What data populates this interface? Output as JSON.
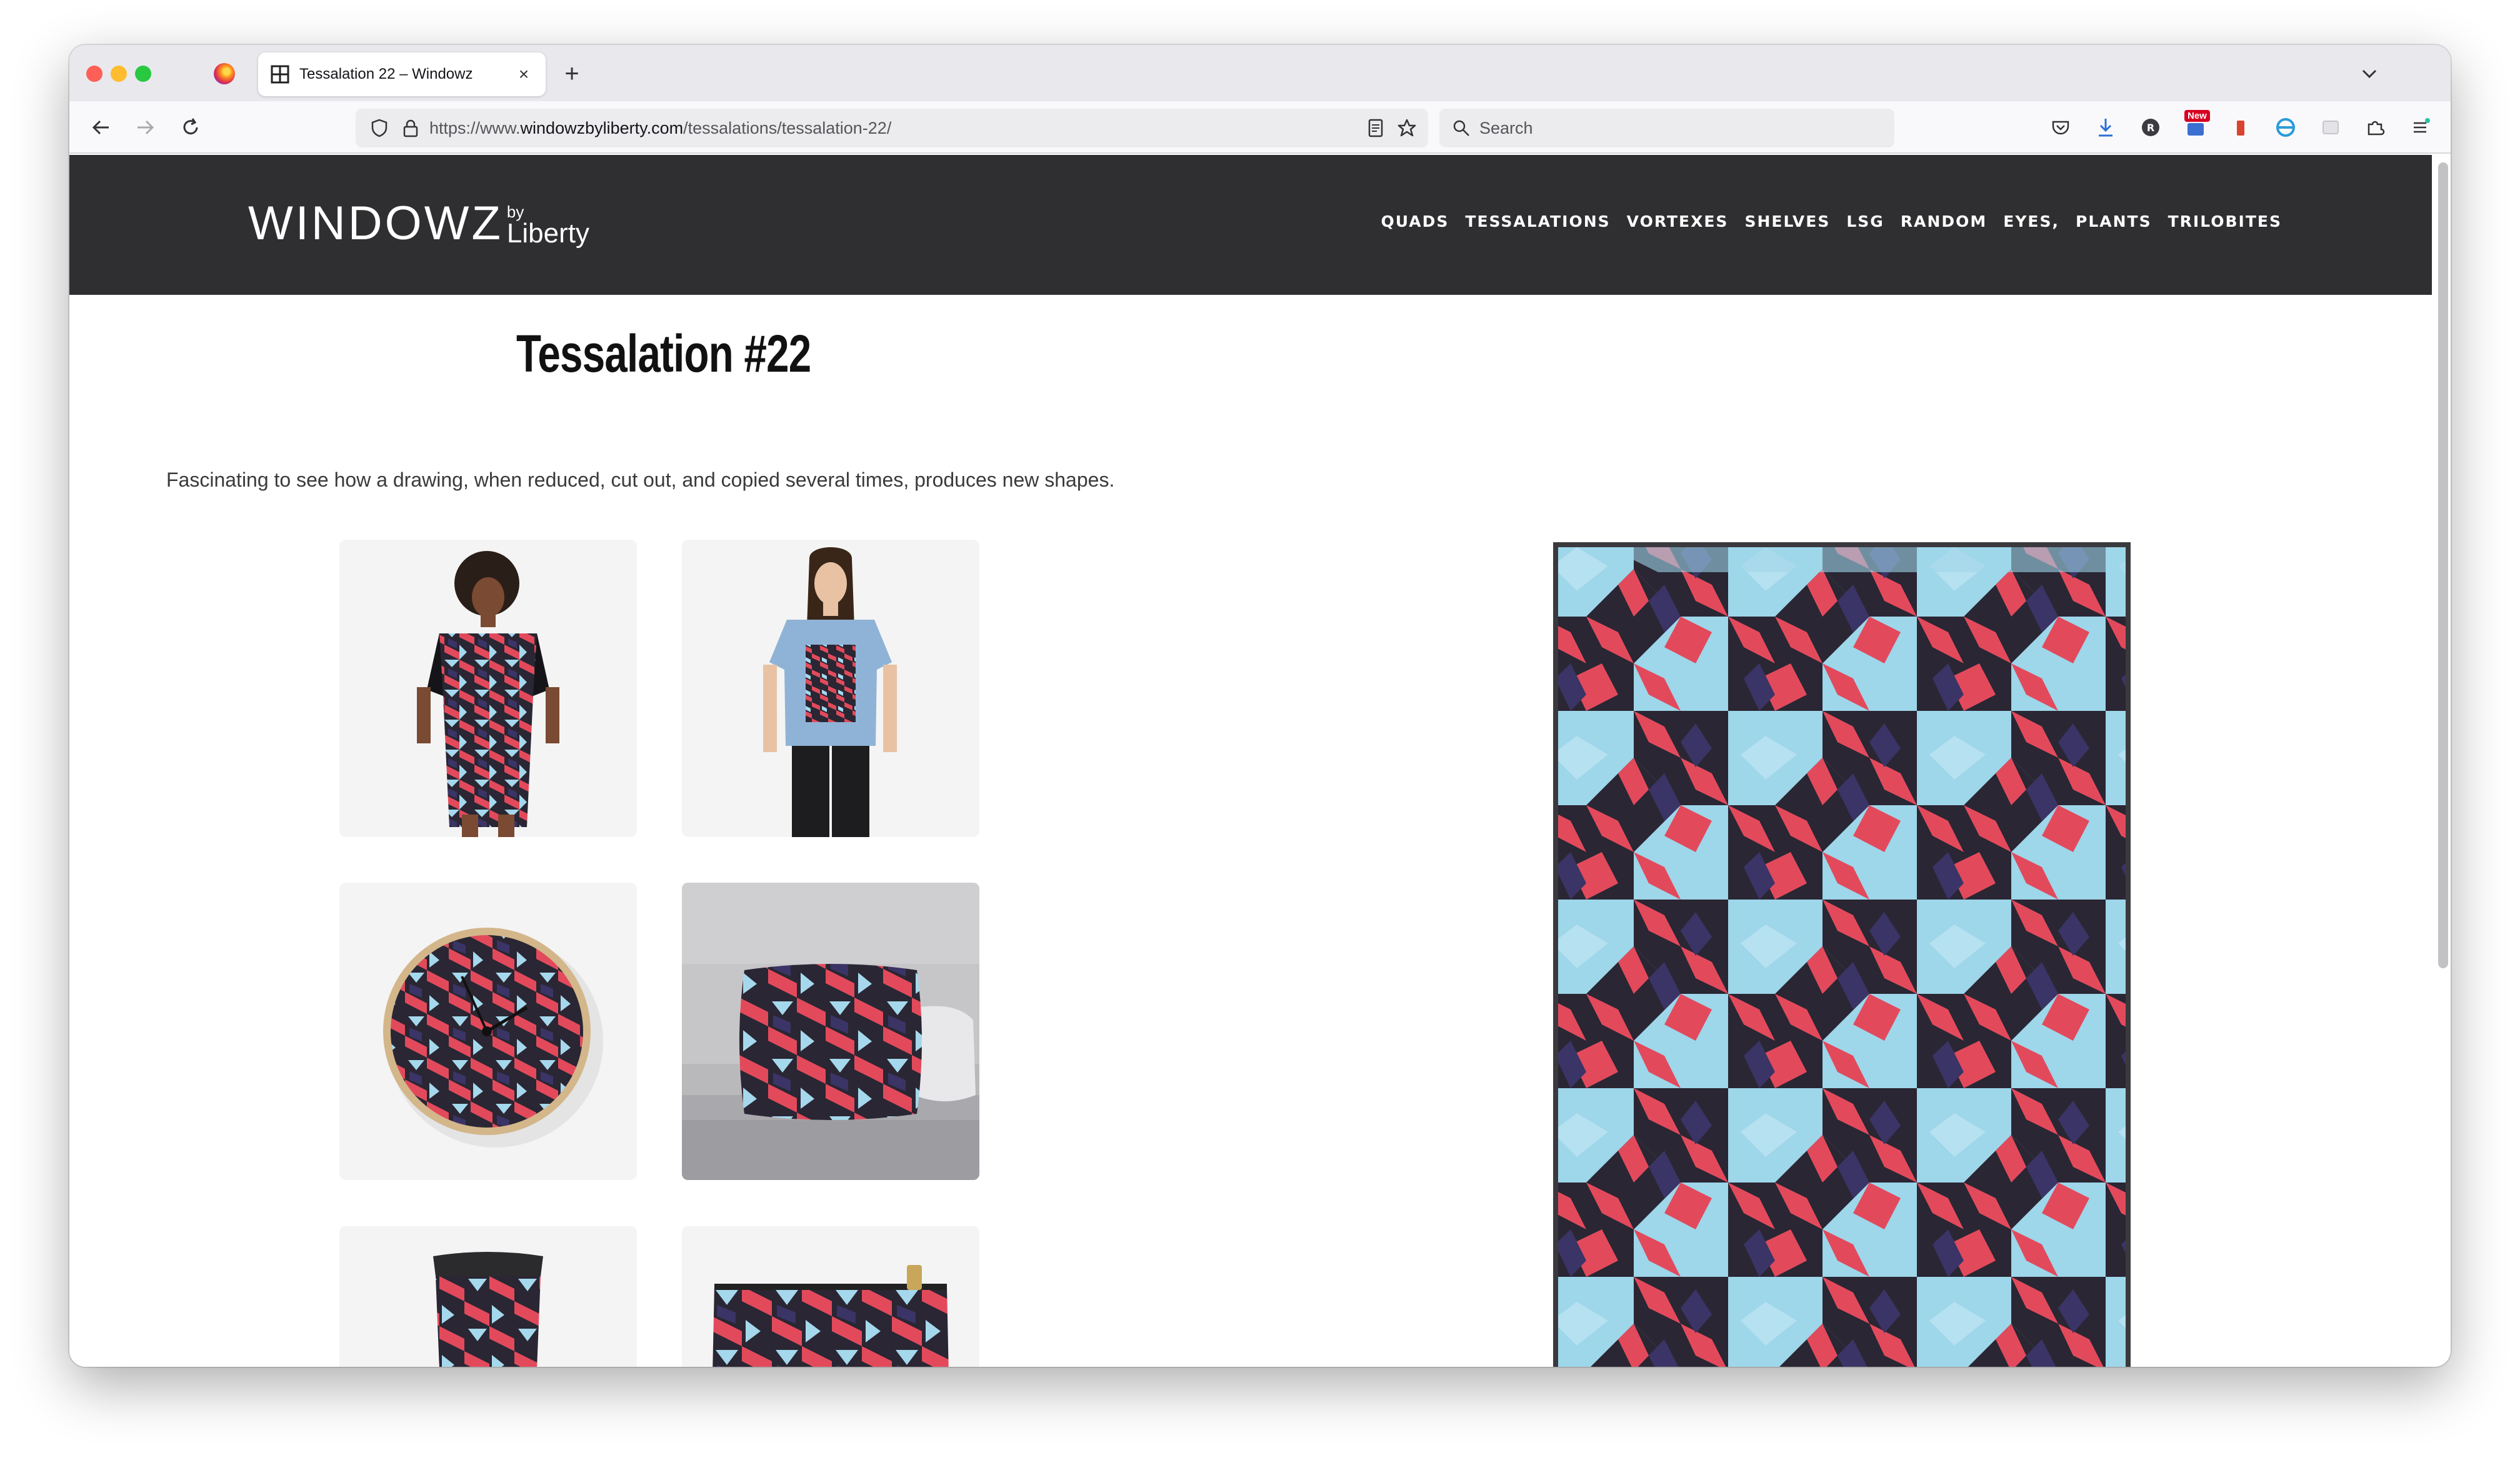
{
  "browser": {
    "tab_title": "Tessalation 22 – Windowz",
    "tab_close": "×",
    "new_tab": "+",
    "url_prefix": "https://www.",
    "url_domain": "windowzbyliberty.com",
    "url_path": "/tessalations/tessalation-22/",
    "search_placeholder": "Search",
    "badge_new": "New"
  },
  "site": {
    "logo_main": "WINDOWZ",
    "logo_by": "by",
    "logo_liberty": "Liberty",
    "menu": [
      "QUADS",
      "TESSALATIONS",
      "VORTEXES",
      "SHELVES",
      "LSG",
      "RANDOM",
      "EYES,",
      "PLANTS",
      "TRILOBITES"
    ]
  },
  "content": {
    "title": "Tessalation #22",
    "description": "Fascinating to see how a drawing, when reduced, cut out, and copied several times, produces new shapes."
  },
  "products": [
    "graphic-tee-dress",
    "fitted-t-shirt",
    "wall-clock",
    "throw-pillow",
    "travel-mug",
    "zipper-pouch"
  ],
  "colors": {
    "pattern_red": "#e24a5c",
    "pattern_dark": "#2a2633",
    "pattern_navy": "#3b3466",
    "pattern_sky": "#a5d8ec",
    "header_bg": "#2f2f31"
  }
}
